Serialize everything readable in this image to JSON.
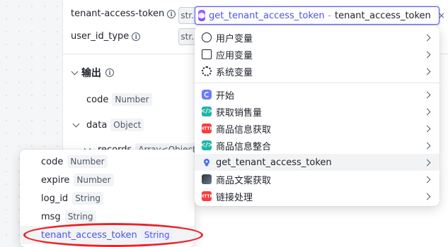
{
  "params": [
    {
      "label": "tenant-access-token",
      "type_abbr": "str."
    },
    {
      "label": "user_id_type",
      "type_abbr": "str."
    }
  ],
  "reference": {
    "node": "get_tenant_access_token",
    "separator": "-",
    "variable": "tenant_access_token",
    "clear_symbol": "×"
  },
  "output": {
    "title": "输出",
    "items": [
      {
        "name": "code",
        "type": "Number"
      },
      {
        "name": "data",
        "type": "Object"
      }
    ],
    "partial_child": {
      "name": "records",
      "type": "Array<Object>"
    }
  },
  "left_dropdown": {
    "items": [
      {
        "name": "code",
        "type": "Number"
      },
      {
        "name": "expire",
        "type": "Number"
      },
      {
        "name": "log_id",
        "type": "String"
      },
      {
        "name": "msg",
        "type": "String"
      },
      {
        "name": "tenant_access_token",
        "type": "String",
        "selected": true
      }
    ]
  },
  "right_dropdown": {
    "groups": [
      [
        {
          "label": "用户变量",
          "icon": "user-icon"
        },
        {
          "label": "应用变量",
          "icon": "folder-icon"
        },
        {
          "label": "系统变量",
          "icon": "gear-icon"
        }
      ],
      [
        {
          "label": "开始",
          "icon": "start-node-icon"
        },
        {
          "label": "获取销售量",
          "icon": "code-node-icon"
        },
        {
          "label": "商品信息获取",
          "icon": "http-node-icon"
        },
        {
          "label": "商品信息整合",
          "icon": "code-node-icon"
        },
        {
          "label": "get_tenant_access_token",
          "icon": "plugin-node-icon",
          "selected": true
        },
        {
          "label": "商品文案获取",
          "icon": "image-node-icon"
        },
        {
          "label": "链接处理",
          "icon": "http-node-icon"
        }
      ]
    ]
  },
  "colors": {
    "accent": "#4d53e8",
    "highlight_ring": "#e8242b",
    "code_icon": "#1fb5a7",
    "http_icon": "#f53f3f",
    "start_icon": "#6b7cff"
  }
}
